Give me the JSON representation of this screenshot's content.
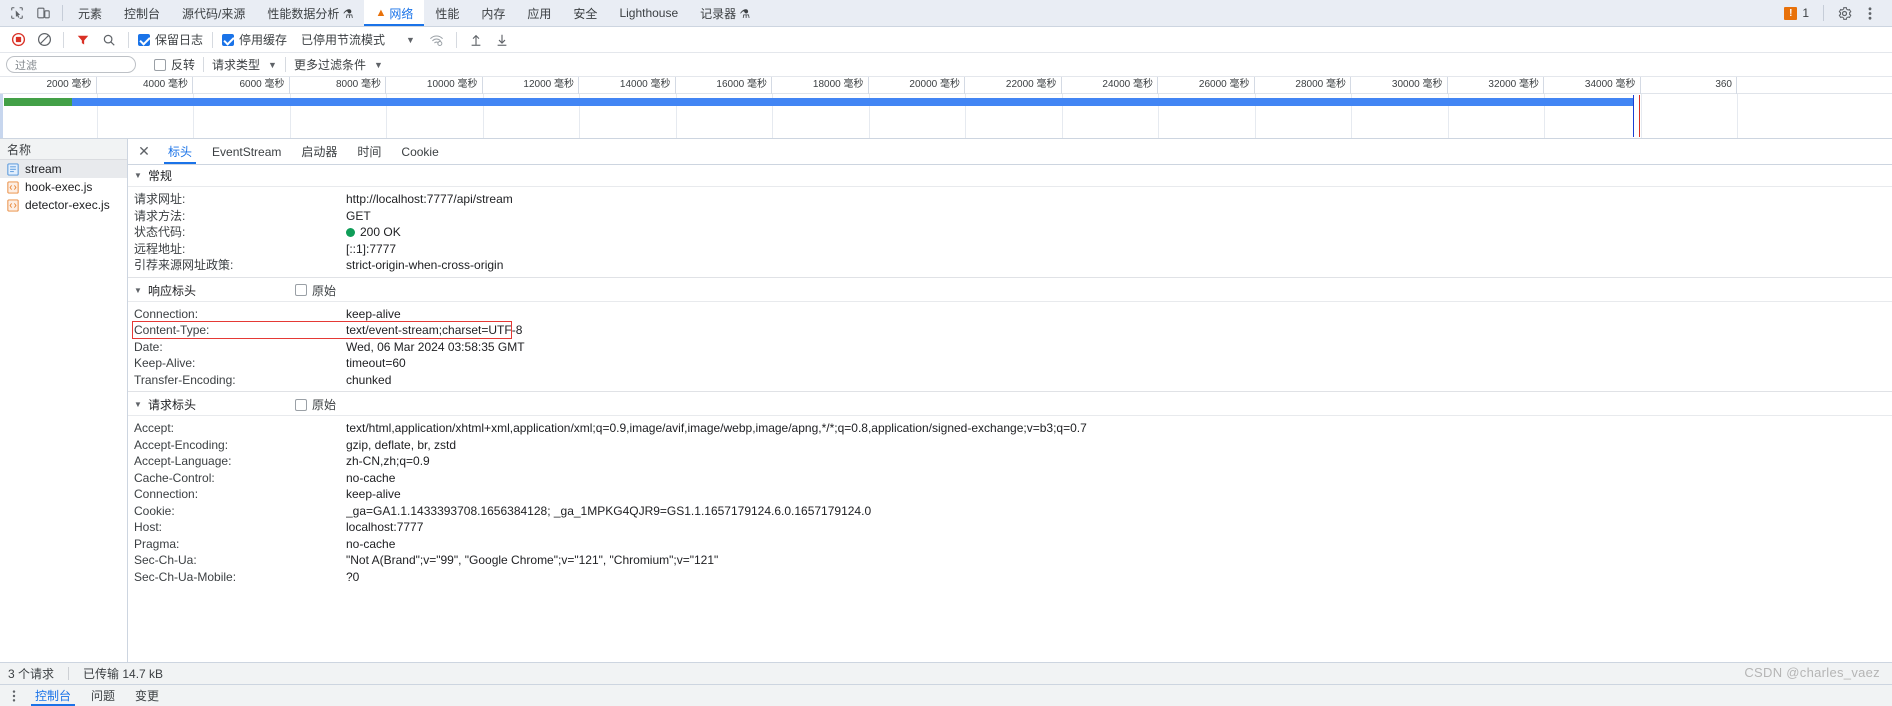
{
  "devtools": {
    "panel_tabs": [
      {
        "label": "元素",
        "active": false,
        "warn": false
      },
      {
        "label": "控制台",
        "active": false,
        "warn": false
      },
      {
        "label": "源代码/来源",
        "active": false,
        "warn": false
      },
      {
        "label": "性能数据分析 ⚗",
        "active": false,
        "warn": false
      },
      {
        "label": "网络",
        "active": true,
        "warn": true
      },
      {
        "label": "性能",
        "active": false,
        "warn": false
      },
      {
        "label": "内存",
        "active": false,
        "warn": false
      },
      {
        "label": "应用",
        "active": false,
        "warn": false
      },
      {
        "label": "安全",
        "active": false,
        "warn": false
      },
      {
        "label": "Lighthouse",
        "active": false,
        "warn": false
      },
      {
        "label": "记录器 ⚗",
        "active": false,
        "warn": false
      }
    ],
    "inspect_icon": "inspect-element-icon",
    "device_icon": "device-toolbar-icon",
    "issues": {
      "count": "1",
      "icon": "issue-warning-icon"
    },
    "settings_icon": "gear-icon",
    "more_icon": "kebab-menu-icon"
  },
  "toolbar": {
    "record_icon": "record-stop-icon",
    "clear_icon": "clear-icon",
    "filter_icon": "filter-icon",
    "search_icon": "search-icon",
    "preserve_log": {
      "label": "保留日志",
      "checked": true
    },
    "disable_cache": {
      "label": "停用缓存",
      "checked": true
    },
    "throttling": {
      "label": "已停用节流模式"
    },
    "wifi_icon": "network-conditions-icon",
    "import_icon": "import-har-icon",
    "export_icon": "export-har-icon"
  },
  "filters": {
    "placeholder": "过滤",
    "value": "",
    "invert": {
      "label": "反转",
      "checked": false
    },
    "request_type": {
      "label": "请求类型"
    },
    "more_filters": {
      "label": "更多过滤条件"
    }
  },
  "overview": {
    "ticks": [
      "2000 毫秒",
      "4000 毫秒",
      "6000 毫秒",
      "8000 毫秒",
      "10000 毫秒",
      "12000 毫秒",
      "14000 毫秒",
      "16000 毫秒",
      "18000 毫秒",
      "20000 毫秒",
      "22000 毫秒",
      "24000 毫秒",
      "26000 毫秒",
      "28000 毫秒",
      "30000 毫秒",
      "32000 毫秒",
      "34000 毫秒",
      "360"
    ],
    "colors": {
      "request_green": "#43a047",
      "request_blue": "#4285f4",
      "dom_blue": "#1a3fd4",
      "load_red": "#d93025"
    }
  },
  "request_list": {
    "header": "名称",
    "items": [
      {
        "name": "stream",
        "icon": "document-icon",
        "selected": true
      },
      {
        "name": "hook-exec.js",
        "icon": "script-icon",
        "selected": false
      },
      {
        "name": "detector-exec.js",
        "icon": "script-icon",
        "selected": false
      }
    ]
  },
  "detail": {
    "close_icon": "close-icon",
    "tabs": [
      {
        "label": "标头",
        "active": true
      },
      {
        "label": "EventStream",
        "active": false
      },
      {
        "label": "启动器",
        "active": false
      },
      {
        "label": "时间",
        "active": false
      },
      {
        "label": "Cookie",
        "active": false
      }
    ],
    "general": {
      "title": "常规",
      "rows": [
        {
          "key": "请求网址:",
          "value": "http://localhost:7777/api/stream"
        },
        {
          "key": "请求方法:",
          "value": "GET"
        },
        {
          "key": "状态代码:",
          "value": "200 OK",
          "dot": true
        },
        {
          "key": "远程地址:",
          "value": "[::1]:7777"
        },
        {
          "key": "引荐来源网址政策:",
          "value": "strict-origin-when-cross-origin"
        }
      ]
    },
    "response_headers": {
      "title": "响应标头",
      "raw_label": "原始",
      "raw_checked": false,
      "rows": [
        {
          "key": "Connection:",
          "value": "keep-alive"
        },
        {
          "key": "Content-Type:",
          "value": "text/event-stream;charset=UTF-8",
          "highlighted": true
        },
        {
          "key": "Date:",
          "value": "Wed, 06 Mar 2024 03:58:35 GMT"
        },
        {
          "key": "Keep-Alive:",
          "value": "timeout=60"
        },
        {
          "key": "Transfer-Encoding:",
          "value": "chunked"
        }
      ]
    },
    "request_headers": {
      "title": "请求标头",
      "raw_label": "原始",
      "raw_checked": false,
      "rows": [
        {
          "key": "Accept:",
          "value": "text/html,application/xhtml+xml,application/xml;q=0.9,image/avif,image/webp,image/apng,*/*;q=0.8,application/signed-exchange;v=b3;q=0.7"
        },
        {
          "key": "Accept-Encoding:",
          "value": "gzip, deflate, br, zstd"
        },
        {
          "key": "Accept-Language:",
          "value": "zh-CN,zh;q=0.9"
        },
        {
          "key": "Cache-Control:",
          "value": "no-cache"
        },
        {
          "key": "Connection:",
          "value": "keep-alive"
        },
        {
          "key": "Cookie:",
          "value": "_ga=GA1.1.1433393708.1656384128; _ga_1MPKG4QJR9=GS1.1.1657179124.6.0.1657179124.0"
        },
        {
          "key": "Host:",
          "value": "localhost:7777"
        },
        {
          "key": "Pragma:",
          "value": "no-cache"
        },
        {
          "key": "Sec-Ch-Ua:",
          "value": "\"Not A(Brand\";v=\"99\", \"Google Chrome\";v=\"121\", \"Chromium\";v=\"121\""
        },
        {
          "key": "Sec-Ch-Ua-Mobile:",
          "value": "?0"
        }
      ]
    }
  },
  "status_bar": {
    "requests": "3 个请求",
    "transferred": "已传输 14.7 kB"
  },
  "drawer": {
    "more_icon": "kebab-menu-icon",
    "tabs": [
      {
        "label": "控制台",
        "active": true
      },
      {
        "label": "问题",
        "active": false
      },
      {
        "label": "变更",
        "active": false
      }
    ]
  },
  "watermark": "CSDN @charles_vaez"
}
